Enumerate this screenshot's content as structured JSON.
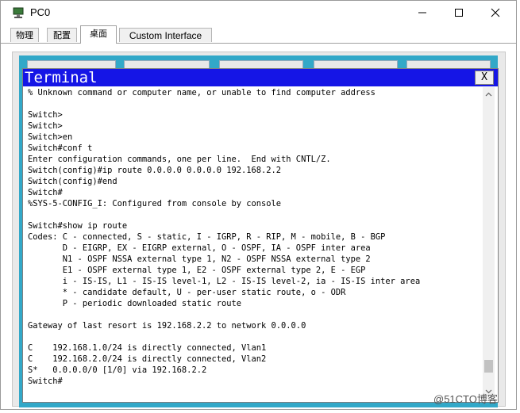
{
  "window": {
    "title": "PC0",
    "controls": {
      "minimize_icon": "minimize-icon",
      "maximize_icon": "maximize-icon",
      "close_icon": "close-icon"
    }
  },
  "tabs": [
    {
      "label": "物理"
    },
    {
      "label": "配置"
    },
    {
      "label": "桌面"
    },
    {
      "label": "Custom Interface"
    }
  ],
  "terminal": {
    "title": "Terminal",
    "close_label": "X",
    "lines": [
      "% Unknown command or computer name, or unable to find computer address",
      "",
      "Switch>",
      "Switch>",
      "Switch>en",
      "Switch#conf t",
      "Enter configuration commands, one per line.  End with CNTL/Z.",
      "Switch(config)#ip route 0.0.0.0 0.0.0.0 192.168.2.2",
      "Switch(config)#end",
      "Switch#",
      "%SYS-5-CONFIG_I: Configured from console by console",
      "",
      "Switch#show ip route",
      "Codes: C - connected, S - static, I - IGRP, R - RIP, M - mobile, B - BGP",
      "       D - EIGRP, EX - EIGRP external, O - OSPF, IA - OSPF inter area",
      "       N1 - OSPF NSSA external type 1, N2 - OSPF NSSA external type 2",
      "       E1 - OSPF external type 1, E2 - OSPF external type 2, E - EGP",
      "       i - IS-IS, L1 - IS-IS level-1, L2 - IS-IS level-2, ia - IS-IS inter area",
      "       * - candidate default, U - per-user static route, o - ODR",
      "       P - periodic downloaded static route",
      "",
      "Gateway of last resort is 192.168.2.2 to network 0.0.0.0",
      "",
      "C    192.168.1.0/24 is directly connected, Vlan1",
      "C    192.168.2.0/24 is directly connected, Vlan2",
      "S*   0.0.0.0/0 [1/0] via 192.168.2.2",
      "Switch#"
    ]
  },
  "watermark": "@51CTO博客",
  "colors": {
    "terminal_title_bg": "#1515e6",
    "desktop_bg": "#32a8c8"
  }
}
